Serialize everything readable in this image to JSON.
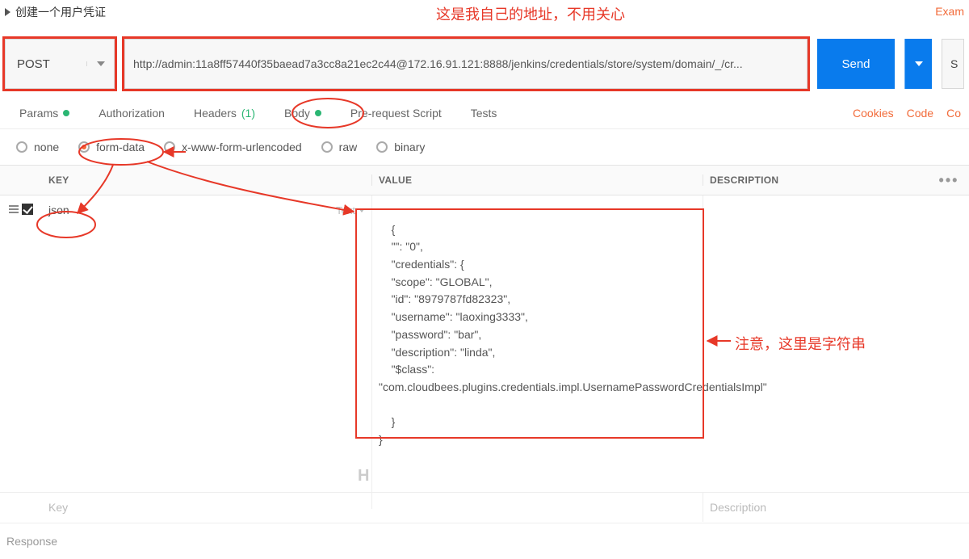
{
  "title": "创建一个用户凭证",
  "top_note": "这是我自己的地址，不用关心",
  "right_cut": "Exam",
  "request": {
    "method": "POST",
    "url": "http://admin:11a8ff57440f35baead7a3cc8a21ec2c44@172.16.91.121:8888/jenkins/credentials/store/system/domain/_/cr...",
    "send_label": "Send",
    "save_stub": "S"
  },
  "tabs": {
    "params": "Params",
    "authorization": "Authorization",
    "headers": "Headers",
    "headers_count": "(1)",
    "body": "Body",
    "prs": "Pre-request Script",
    "tests": "Tests"
  },
  "tabs_right": {
    "cookies": "Cookies",
    "code": "Code",
    "co": "Co"
  },
  "body_types": {
    "none": "none",
    "form_data": "form-data",
    "xwww": "x-www-form-urlencoded",
    "raw": "raw",
    "binary": "binary"
  },
  "kv": {
    "head_key": "KEY",
    "head_value": "VALUE",
    "head_desc": "DESCRIPTION",
    "more": "•••",
    "row0": {
      "key": "json",
      "key_type": "Text",
      "value": "{\n    \"\": \"0\",\n    \"credentials\": {\n    \"scope\": \"GLOBAL\",\n    \"id\": \"8979787fd82323\",\n    \"username\": \"laoxing3333\",\n    \"password\": \"bar\",\n    \"description\": \"linda\",\n    \"$class\":\n\"com.cloudbees.plugins.credentials.impl.UsernamePasswordCredentialsImpl\"\n\n    }\n}"
    },
    "placeholder_key": "Key",
    "placeholder_desc": "Description"
  },
  "response_label": "Response",
  "bottom_note": "注意，这里是字符串",
  "hiddenH": "H"
}
